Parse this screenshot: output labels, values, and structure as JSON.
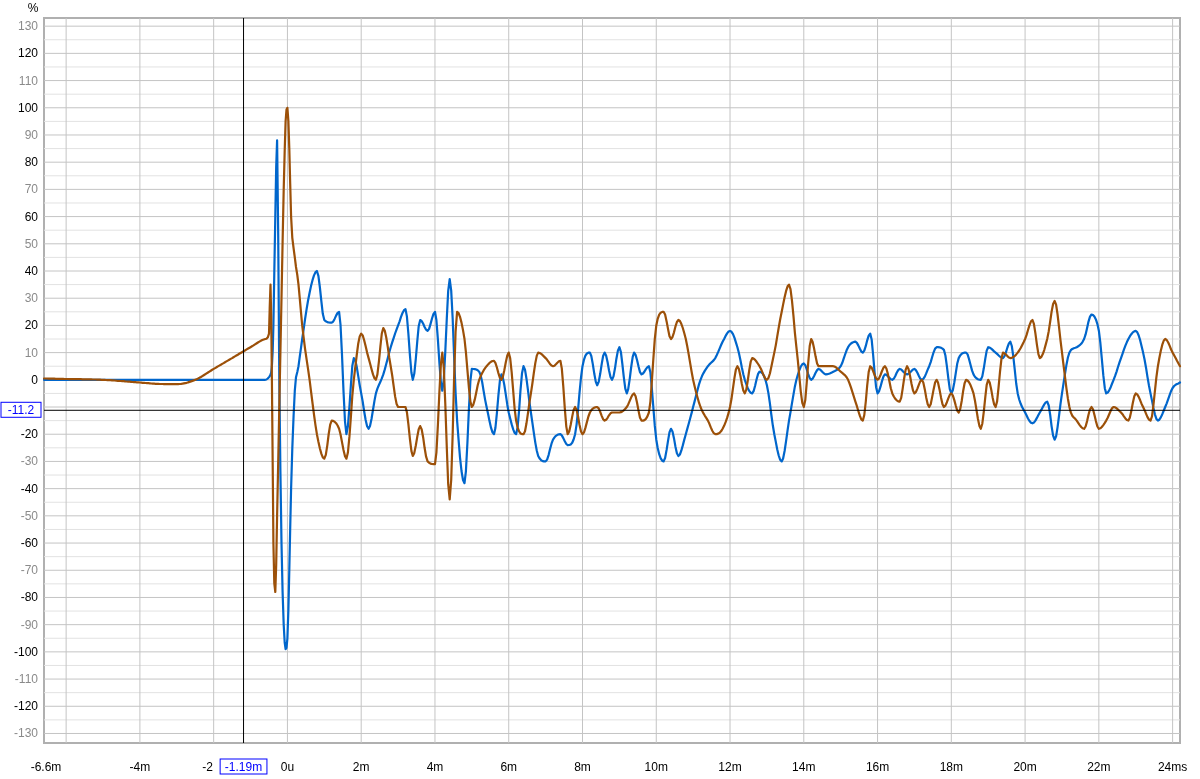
{
  "chart_data": {
    "type": "line",
    "ylabel": "%",
    "x": [
      -6.6,
      -6,
      -5,
      -4,
      -3.5,
      -3,
      -2.5,
      -2,
      -1.5,
      -1,
      -0.6,
      -0.5,
      -0.46,
      -0.42,
      -0.38,
      -0.33,
      -0.28,
      -0.22,
      -0.16,
      -0.1,
      -0.05,
      0,
      0.05,
      0.1,
      0.2,
      0.3,
      0.4,
      0.6,
      0.8,
      1,
      1.2,
      1.4,
      1.6,
      1.8,
      2,
      2.2,
      2.4,
      2.6,
      2.8,
      3,
      3.2,
      3.4,
      3.6,
      3.8,
      4,
      4.2,
      4.4,
      4.6,
      4.8,
      5,
      5.2,
      5.4,
      5.6,
      5.8,
      6,
      6.2,
      6.4,
      6.6,
      6.8,
      7,
      7.2,
      7.4,
      7.6,
      7.8,
      8,
      8.2,
      8.4,
      8.6,
      8.8,
      9,
      9.2,
      9.4,
      9.6,
      9.8,
      10,
      10.2,
      10.4,
      10.6,
      10.8,
      11,
      11.2,
      11.4,
      11.6,
      11.8,
      12,
      12.2,
      12.4,
      12.6,
      12.8,
      13,
      13.2,
      13.4,
      13.6,
      13.8,
      14,
      14.2,
      14.4,
      14.6,
      14.8,
      15,
      15.2,
      15.4,
      15.6,
      15.8,
      16,
      16.2,
      16.4,
      16.6,
      16.8,
      17,
      17.2,
      17.4,
      17.6,
      17.8,
      18,
      18.2,
      18.4,
      18.6,
      18.8,
      19,
      19.2,
      19.4,
      19.6,
      19.8,
      20,
      20.2,
      20.4,
      20.6,
      20.8,
      21,
      21.2,
      21.4,
      21.6,
      21.8,
      22,
      22.2,
      22.4,
      22.6,
      22.8,
      23,
      23.2,
      23.4,
      23.6,
      23.8,
      24,
      24.2
    ],
    "series": [
      {
        "color": "#0066cc",
        "values": [
          0,
          0,
          0,
          0,
          0,
          0,
          0,
          0,
          0,
          0,
          0,
          1,
          2,
          5,
          20,
          60,
          88,
          0,
          -60,
          -90,
          -99,
          -95,
          -70,
          -40,
          -4,
          5,
          15,
          32,
          40,
          22,
          21,
          25,
          -20,
          8,
          -5,
          -18,
          -5,
          2,
          12,
          20,
          26,
          0,
          22,
          18,
          25,
          -4,
          37,
          -15,
          -38,
          4,
          3,
          -10,
          -20,
          2,
          -12,
          -20,
          5,
          -12,
          -28,
          -30,
          -22,
          -20,
          -24,
          -20,
          5,
          10,
          -2,
          10,
          0,
          12,
          -5,
          10,
          2,
          5,
          -22,
          -30,
          -18,
          -28,
          -20,
          -10,
          0,
          5,
          8,
          14,
          18,
          12,
          0,
          -5,
          3,
          -2,
          -20,
          -30,
          -15,
          0,
          6,
          0,
          4,
          2,
          3,
          5,
          12,
          14,
          10,
          17,
          -5,
          2,
          0,
          4,
          2,
          4,
          0,
          5,
          12,
          11,
          -5,
          8,
          10,
          2,
          0,
          12,
          10,
          8,
          14,
          -5,
          -12,
          -16,
          -12,
          -8,
          -22,
          -5,
          10,
          12,
          15,
          24,
          18,
          -5,
          0,
          8,
          15,
          18,
          10,
          -5,
          -15,
          -10,
          -3,
          -1
        ]
      },
      {
        "color": "#9c5008",
        "values": [
          0.5,
          0.3,
          0,
          -1,
          -1.5,
          -1.6,
          0,
          4,
          8,
          12,
          15,
          17,
          35,
          0,
          -60,
          -78,
          -50,
          -10,
          30,
          70,
          95,
          100,
          85,
          60,
          45,
          35,
          20,
          0,
          -20,
          -29,
          -15,
          -18,
          -29,
          0,
          17,
          8,
          0,
          19,
          5,
          -10,
          -10,
          -28,
          -17,
          -30,
          -31,
          10,
          -44,
          25,
          15,
          -10,
          0,
          5,
          7,
          0,
          10,
          -15,
          -20,
          -5,
          10,
          8,
          5,
          7,
          -20,
          -10,
          -20,
          -12,
          -10,
          -15,
          -12,
          -12,
          -10,
          -5,
          -15,
          -12,
          20,
          25,
          15,
          22,
          15,
          0,
          -10,
          -15,
          -20,
          -18,
          -10,
          5,
          -5,
          8,
          5,
          0,
          10,
          25,
          35,
          12,
          -10,
          15,
          5,
          5,
          5,
          3,
          0,
          -8,
          -15,
          5,
          0,
          5,
          -5,
          -8,
          5,
          -5,
          0,
          -10,
          0,
          -10,
          -5,
          -12,
          0,
          -5,
          -18,
          0,
          -10,
          10,
          8,
          10,
          15,
          22,
          8,
          15,
          29,
          10,
          -10,
          -15,
          -18,
          -10,
          -18,
          -15,
          -10,
          -12,
          -15,
          -5,
          -10,
          -15,
          5,
          15,
          10,
          5
        ]
      }
    ],
    "xlim": [
      -6.6,
      24.2
    ],
    "ylim": [
      -133.5,
      133
    ],
    "xticks": [
      {
        "value": -6.6,
        "label": "-6.6m"
      },
      {
        "value": -4,
        "label": "-4m"
      },
      {
        "value": -2,
        "label": "-2"
      },
      {
        "value": 0,
        "label": "0u"
      },
      {
        "value": 2,
        "label": "2m"
      },
      {
        "value": 4,
        "label": "4m"
      },
      {
        "value": 6,
        "label": "6m"
      },
      {
        "value": 8,
        "label": "8m"
      },
      {
        "value": 10,
        "label": "10m"
      },
      {
        "value": 12,
        "label": "12m"
      },
      {
        "value": 14,
        "label": "14m"
      },
      {
        "value": 16,
        "label": "16m"
      },
      {
        "value": 18,
        "label": "18m"
      },
      {
        "value": 20,
        "label": "20m"
      },
      {
        "value": 22,
        "label": "22m"
      },
      {
        "value": 24,
        "label": "24ms"
      }
    ],
    "yticks": [
      -130,
      -120,
      -110,
      -100,
      -90,
      -80,
      -70,
      -60,
      -50,
      -40,
      -30,
      -20,
      -10,
      0,
      10,
      20,
      30,
      40,
      50,
      60,
      70,
      80,
      90,
      100,
      110,
      120,
      130
    ],
    "grid": true,
    "ref_lines": [
      {
        "axis": "x",
        "value": -1.19,
        "label": "-1.19m"
      },
      {
        "axis": "y",
        "value": -11.2,
        "label": "-11.2"
      }
    ]
  }
}
